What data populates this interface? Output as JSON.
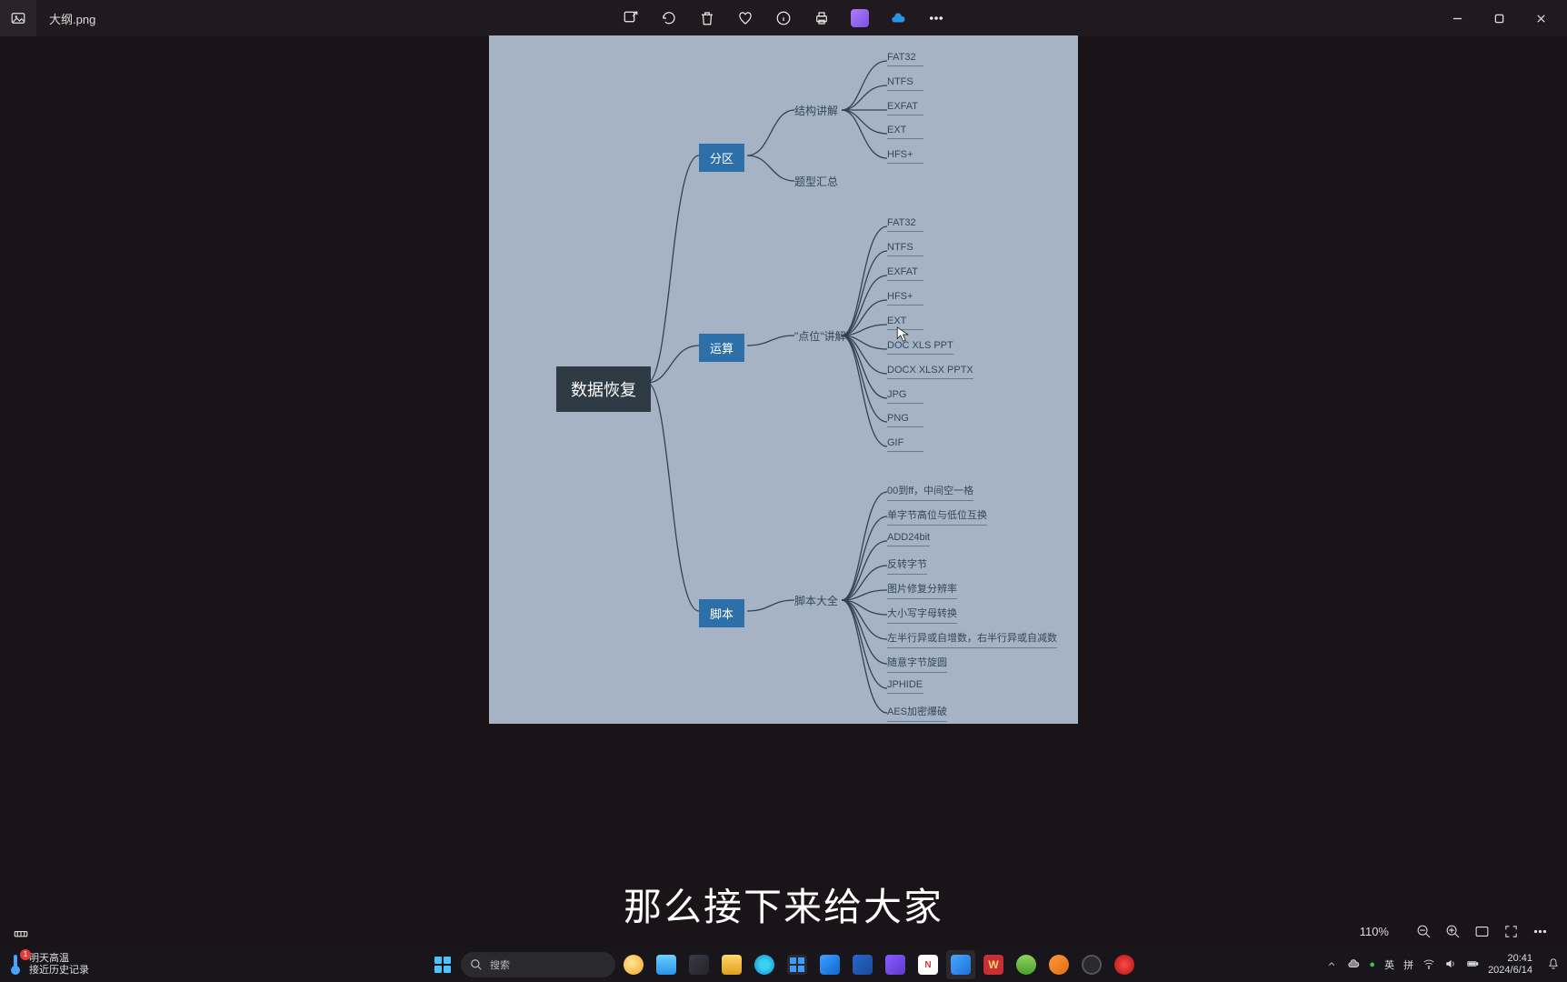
{
  "titlebar": {
    "filename": "大纲.png"
  },
  "mindmap": {
    "root": "数据恢复",
    "branches": [
      {
        "name": "分区",
        "subs": [
          {
            "name": "结构讲解",
            "leaves": [
              "FAT32",
              "NTFS",
              "EXFAT",
              "EXT",
              "HFS+"
            ]
          },
          {
            "name": "题型汇总",
            "leaves": []
          }
        ]
      },
      {
        "name": "运算",
        "subs": [
          {
            "name": "\"点位\"讲解",
            "leaves": [
              "FAT32",
              "NTFS",
              "EXFAT",
              "HFS+",
              "EXT",
              "DOC XLS PPT",
              "DOCX XLSX PPTX",
              "JPG",
              "PNG",
              "GIF"
            ]
          }
        ]
      },
      {
        "name": "脚本",
        "subs": [
          {
            "name": "脚本大全",
            "leaves": [
              "00到ff，中间空一格",
              "单字节高位与低位互换",
              "ADD24bit",
              "反转字节",
              "图片修复分辨率",
              "大小写字母转换",
              "左半行异或自增数，右半行异或自减数",
              "随意字节旋圆",
              "JPHIDE",
              "AES加密爆破"
            ]
          }
        ]
      }
    ]
  },
  "subtitle": "那么接下来给大家",
  "status": {
    "zoom": "110%"
  },
  "taskbar": {
    "weather_line1": "明天高温",
    "weather_line2": "接近历史记录",
    "weather_badge": "1",
    "search_placeholder": "搜索",
    "ime_lang": "英",
    "ime_mode": "拼",
    "clock_time": "20:41",
    "clock_date": "2024/6/14"
  }
}
